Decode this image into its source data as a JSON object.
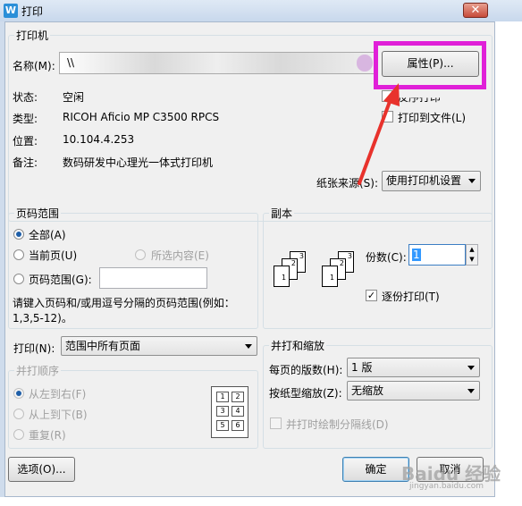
{
  "window": {
    "title": "打印",
    "app_icon_letter": "W",
    "close_symbol": "✕"
  },
  "printer_group": {
    "label": "打印机",
    "name_label": "名称(M):",
    "name_value": "\\\\",
    "properties_button": "属性(P)...",
    "status_label": "状态:",
    "status_value": "空闲",
    "type_label": "类型:",
    "type_value": "RICOH Aficio MP C3500 RPCS",
    "location_label": "位置:",
    "location_value": "10.104.4.253",
    "comment_label": "备注:",
    "comment_value": "数码研发中心理光一体式打印机",
    "reverse_print": "反序打印",
    "print_to_file": "打印到文件(L)",
    "paper_source_label": "纸张来源(S):",
    "paper_source_value": "使用打印机设置"
  },
  "page_range": {
    "label": "页码范围",
    "all": "全部(A)",
    "current": "当前页(U)",
    "selection": "所选内容(E)",
    "pages": "页码范围(G):",
    "pages_value": "",
    "hint_line1": "请键入页码和/或用逗号分隔的页码范围(例如：",
    "hint_line2": "1,3,5-12)。"
  },
  "copies": {
    "label": "副本",
    "count_label": "份数(C):",
    "count_value": "1",
    "collate_label": "逐份打印(T)",
    "collate_checked": true
  },
  "print_what": {
    "label": "打印(N):",
    "value": "范围中所有页面"
  },
  "order": {
    "label": "并打顺序",
    "left_to_right": "从左到右(F)",
    "top_to_bottom": "从上到下(B)",
    "repeat": "重复(R)",
    "grid_numbers": [
      "1",
      "2",
      "3",
      "4",
      "5",
      "6"
    ]
  },
  "zoom": {
    "label": "并打和缩放",
    "pages_per_sheet_label": "每页的版数(H):",
    "pages_per_sheet_value": "1 版",
    "scale_label": "按纸型缩放(Z):",
    "scale_value": "无缩放",
    "draw_borders": "并打时绘制分隔线(D)"
  },
  "footer": {
    "options_button": "选项(O)...",
    "ok_button": "确定",
    "cancel_button": "取消",
    "watermark": "Baidu 经验",
    "watermark_url": "jingyan.baidu.com"
  },
  "colors": {
    "highlight": "#e020d8",
    "arrow": "#e8322c"
  }
}
